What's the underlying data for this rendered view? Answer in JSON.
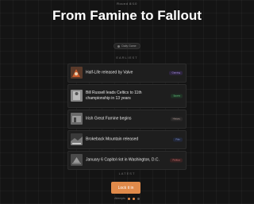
{
  "header": {
    "top_label": "Round 8/10",
    "title": "From Famine to Fallout",
    "pill_label": "Daily Game"
  },
  "timeline": {
    "earliest_label": "EARLIEST",
    "latest_label": "LATEST",
    "items": [
      {
        "text": "Half-Life released by Valve",
        "badge": "Gaming",
        "badge_color": "#b59cf0"
      },
      {
        "text": "Bill Russell leads Celtics to 11th championship in 13 years",
        "badge": "Sports",
        "badge_color": "#6fd08a"
      },
      {
        "text": "Irish Great Famine begins",
        "badge": "History",
        "badge_color": "#c0a8a0"
      },
      {
        "text": "Brokeback Mountain released",
        "badge": "Film",
        "badge_color": "#8fa3e8"
      },
      {
        "text": "January 6 Capitol riot in Washington, D.C.",
        "badge": "Politics",
        "badge_color": "#e07a7a"
      }
    ]
  },
  "actions": {
    "lock_label": "Lock it in"
  },
  "footer": {
    "attempts_label": "Attempts"
  },
  "colors": {
    "accent": "#e08a4a",
    "background": "#141414"
  }
}
